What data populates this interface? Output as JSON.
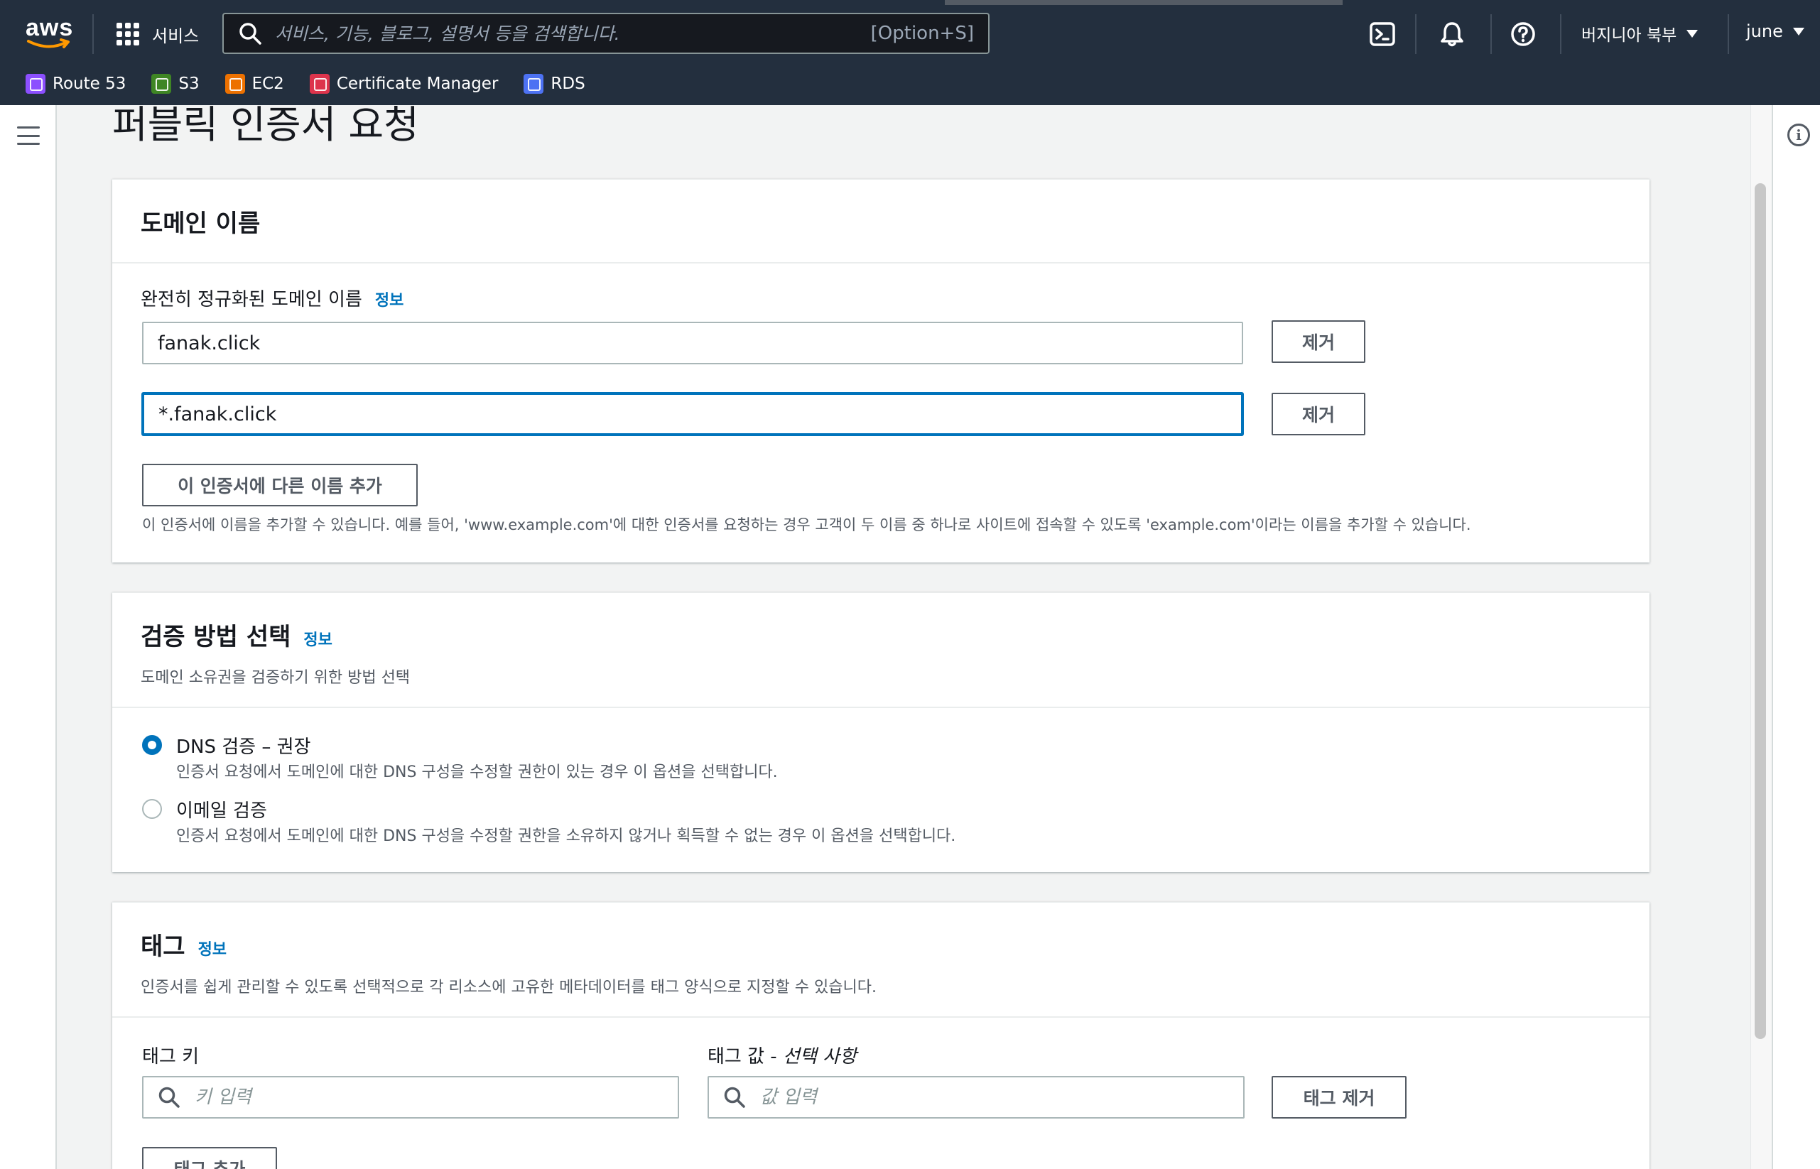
{
  "nav": {
    "services_label": "서비스",
    "search_placeholder": "서비스, 기능, 블로그, 설명서 등을 검색합니다.",
    "search_shortcut": "[Option+S]",
    "region": "버지니아 북부",
    "user": "june",
    "favorites": [
      {
        "label": "Route 53",
        "color": "#8c4fff"
      },
      {
        "label": "S3",
        "color": "#3f8624"
      },
      {
        "label": "EC2",
        "color": "#ed7100"
      },
      {
        "label": "Certificate Manager",
        "color": "#dd344c"
      },
      {
        "label": "RDS",
        "color": "#4d72f3"
      }
    ]
  },
  "page": {
    "title": "퍼블릭 인증서 요청"
  },
  "domain_panel": {
    "heading": "도메인 이름",
    "fqdn_label": "완전히 정규화된 도메인 이름",
    "info": "정보",
    "domains": [
      "fanak.click",
      "*.fanak.click"
    ],
    "remove_label": "제거",
    "add_name_label": "이 인증서에 다른 이름 추가",
    "hint": "이 인증서에 이름을 추가할 수 있습니다. 예를 들어, 'www.example.com'에 대한 인증서를 요청하는 경우 고객이 두 이름 중 하나로 사이트에 접속할 수 있도록 'example.com'이라는 이름을 추가할 수 있습니다."
  },
  "validation_panel": {
    "heading": "검증 방법 선택",
    "info": "정보",
    "description": "도메인 소유권을 검증하기 위한 방법 선택",
    "dns_label": "DNS 검증 – 권장",
    "dns_desc": "인증서 요청에서 도메인에 대한 DNS 구성을 수정할 권한이 있는 경우 이 옵션을 선택합니다.",
    "email_label": "이메일 검증",
    "email_desc": "인증서 요청에서 도메인에 대한 DNS 구성을 수정할 권한을 소유하지 않거나 획득할 수 없는 경우 이 옵션을 선택합니다.",
    "selected": "dns"
  },
  "tags_panel": {
    "heading": "태그",
    "info": "정보",
    "description": "인증서를 쉽게 관리할 수 있도록 선택적으로 각 리소스에 고유한 메타데이터를 태그 양식으로 지정할 수 있습니다.",
    "key_label": "태그 키",
    "value_label": "태그 값 -",
    "value_optional": "선택 사항",
    "key_placeholder": "키 입력",
    "value_placeholder": "값 입력",
    "remove_tag_label": "태그 제거",
    "add_tag_label": "태그 추가"
  }
}
